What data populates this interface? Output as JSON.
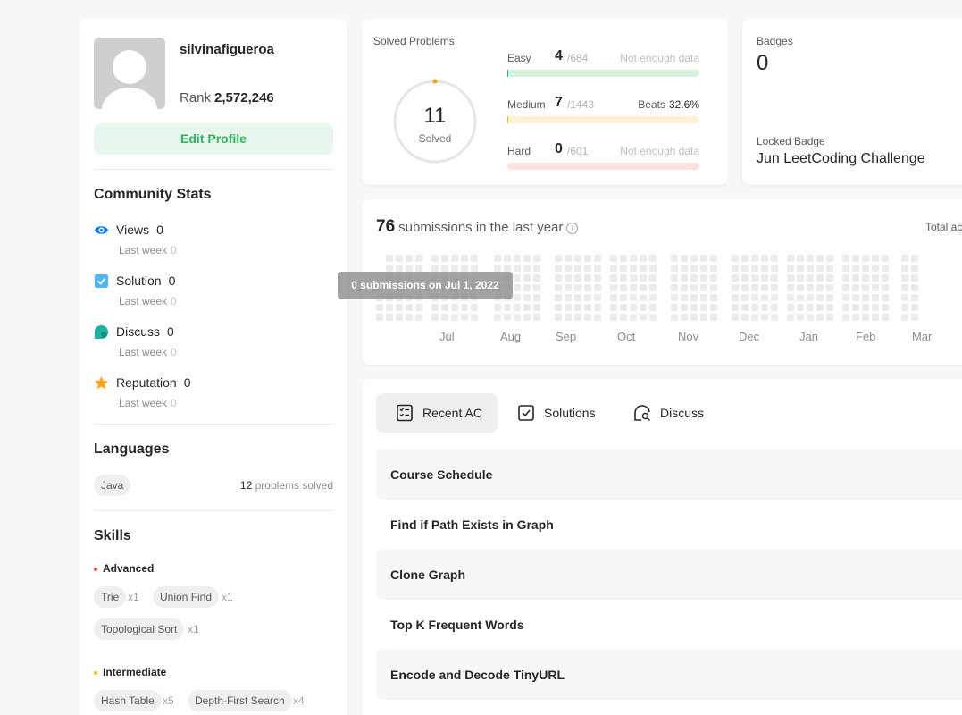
{
  "profile": {
    "username": "silvinafigueroa",
    "rank_label": "Rank",
    "rank_value": "2,572,246",
    "edit_label": "Edit Profile"
  },
  "community": {
    "title": "Community Stats",
    "items": [
      {
        "label": "Views",
        "value": "0",
        "sub_label": "Last week",
        "sub_value": "0",
        "icon": "eye-icon",
        "color": "#007aff"
      },
      {
        "label": "Solution",
        "value": "0",
        "sub_label": "Last week",
        "sub_value": "0",
        "icon": "check-square-icon",
        "color": "#4fb6f0"
      },
      {
        "label": "Discuss",
        "value": "0",
        "sub_label": "Last week",
        "sub_value": "0",
        "icon": "chat-bubble-icon",
        "color": "#20b2a0"
      },
      {
        "label": "Reputation",
        "value": "0",
        "sub_label": "Last week",
        "sub_value": "0",
        "icon": "star-icon",
        "color": "#ffa116"
      }
    ]
  },
  "languages": {
    "title": "Languages",
    "items": [
      {
        "name": "Java",
        "count": "12",
        "suffix": "problems solved"
      }
    ]
  },
  "skills": {
    "title": "Skills",
    "groups": [
      {
        "level": "Advanced",
        "color": "#ef4743",
        "tags": [
          {
            "name": "Trie",
            "mult": "x1"
          },
          {
            "name": "Union Find",
            "mult": "x1"
          },
          {
            "name": "Topological Sort",
            "mult": "x1"
          }
        ]
      },
      {
        "level": "Intermediate",
        "color": "#ffb800",
        "tags": [
          {
            "name": "Hash Table",
            "mult": "x5"
          },
          {
            "name": "Depth-First Search",
            "mult": "x4"
          }
        ]
      }
    ]
  },
  "solved": {
    "title": "Solved Problems",
    "total": "11",
    "total_label": "Solved",
    "difficulties": [
      {
        "name": "Easy",
        "count": "4",
        "total": "/684",
        "note": "Not enough data",
        "color": "#00b8a3",
        "track": "#d6f1de",
        "fraction": 0.006
      },
      {
        "name": "Medium",
        "count": "7",
        "total": "/1443",
        "beats_label": "Beats",
        "beats_value": "32.6%",
        "color": "#ffb800",
        "track": "#fdf0d8",
        "fraction": 0.005
      },
      {
        "name": "Hard",
        "count": "0",
        "total": "/601",
        "note": "Not enough data",
        "color": "#ef4743",
        "track": "#fbe1e0",
        "fraction": 0
      }
    ]
  },
  "badges": {
    "title": "Badges",
    "count": "0",
    "locked_label": "Locked Badge",
    "locked_name": "Jun LeetCoding Challenge"
  },
  "heatmap": {
    "count": "76",
    "suffix": "submissions in the last year",
    "total_active": "Total ac",
    "months": [
      "Jul",
      "Aug",
      "Sep",
      "Oct",
      "Nov",
      "Dec",
      "Jan",
      "Feb",
      "Mar"
    ],
    "tooltip": "0 submissions on Jul 1, 2022"
  },
  "recent": {
    "tabs": [
      {
        "label": "Recent AC",
        "icon": "list-check-icon"
      },
      {
        "label": "Solutions",
        "icon": "check-box-icon"
      },
      {
        "label": "Discuss",
        "icon": "chat-search-icon"
      }
    ],
    "items": [
      "Course Schedule",
      "Find if Path Exists in Graph",
      "Clone Graph",
      "Top K Frequent Words",
      "Encode and Decode TinyURL"
    ]
  }
}
